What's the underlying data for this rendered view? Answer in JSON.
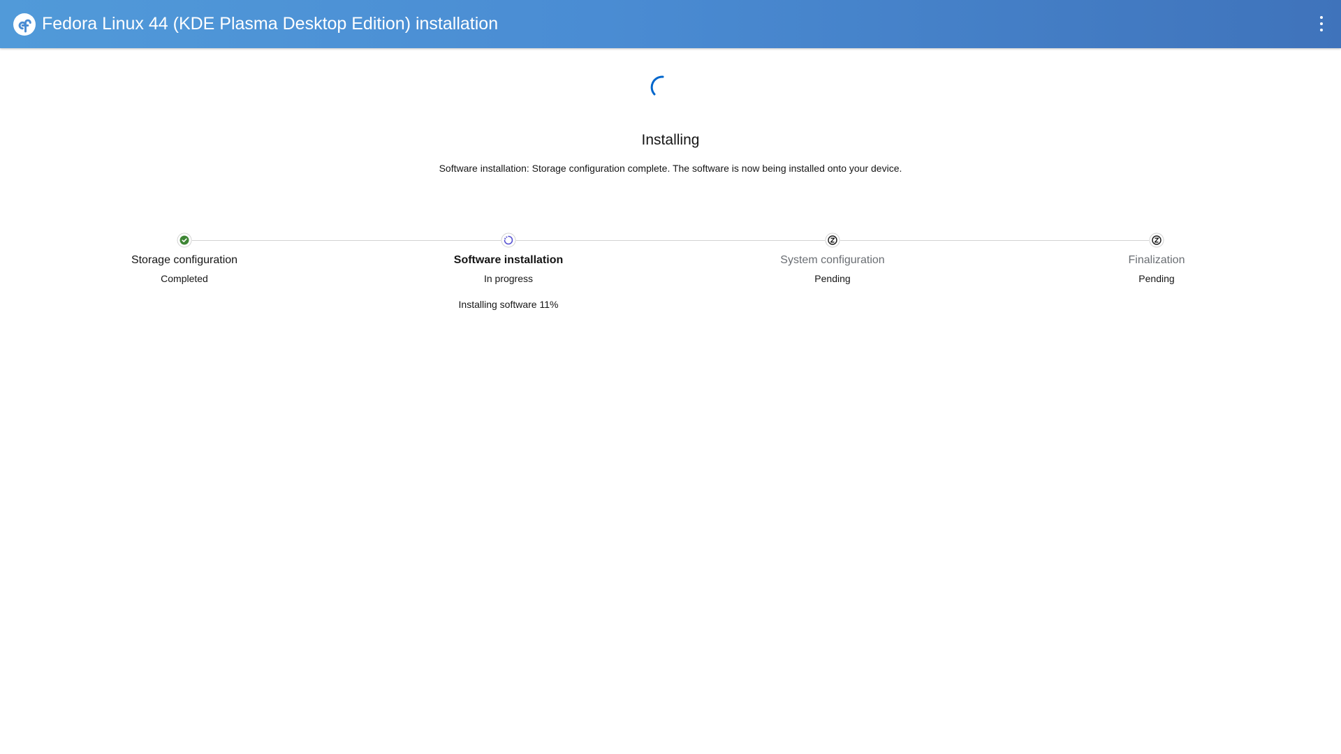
{
  "header": {
    "title": "Fedora Linux 44 (KDE Plasma Desktop Edition) installation",
    "logo_icon": "fedora-logo-icon",
    "menu_icon": "kebab-menu-icon"
  },
  "main": {
    "spinner_icon": "loading-spinner-icon",
    "heading": "Installing",
    "description": "Software installation: Storage configuration complete. The software is now being installed onto your device."
  },
  "steps": [
    {
      "title": "Storage configuration",
      "status": "Completed",
      "detail": "",
      "icon": "check-circle-icon"
    },
    {
      "title": "Software installation",
      "status": "In progress",
      "detail": "Installing software 11%",
      "icon": "in-progress-icon"
    },
    {
      "title": "System configuration",
      "status": "Pending",
      "detail": "",
      "icon": "pending-icon"
    },
    {
      "title": "Finalization",
      "status": "Pending",
      "detail": "",
      "icon": "pending-icon"
    }
  ],
  "colors": {
    "header_start": "#519ad9",
    "header_end": "#3f73bb",
    "spinner": "#0066cc",
    "completed": "#3e8635",
    "in_progress": "#5752d1"
  }
}
